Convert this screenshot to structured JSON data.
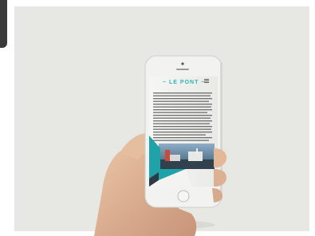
{
  "screen": {
    "heading": "~ LE PONT ~"
  },
  "colors": {
    "background": "#e7e7e4",
    "accent_teal": "#1fa3a8",
    "phone_body": "#f3f3f1",
    "skin": "#e0b79a"
  },
  "icons": [
    "menu-icon",
    "home-button-icon",
    "camera-icon",
    "speaker-icon"
  ]
}
